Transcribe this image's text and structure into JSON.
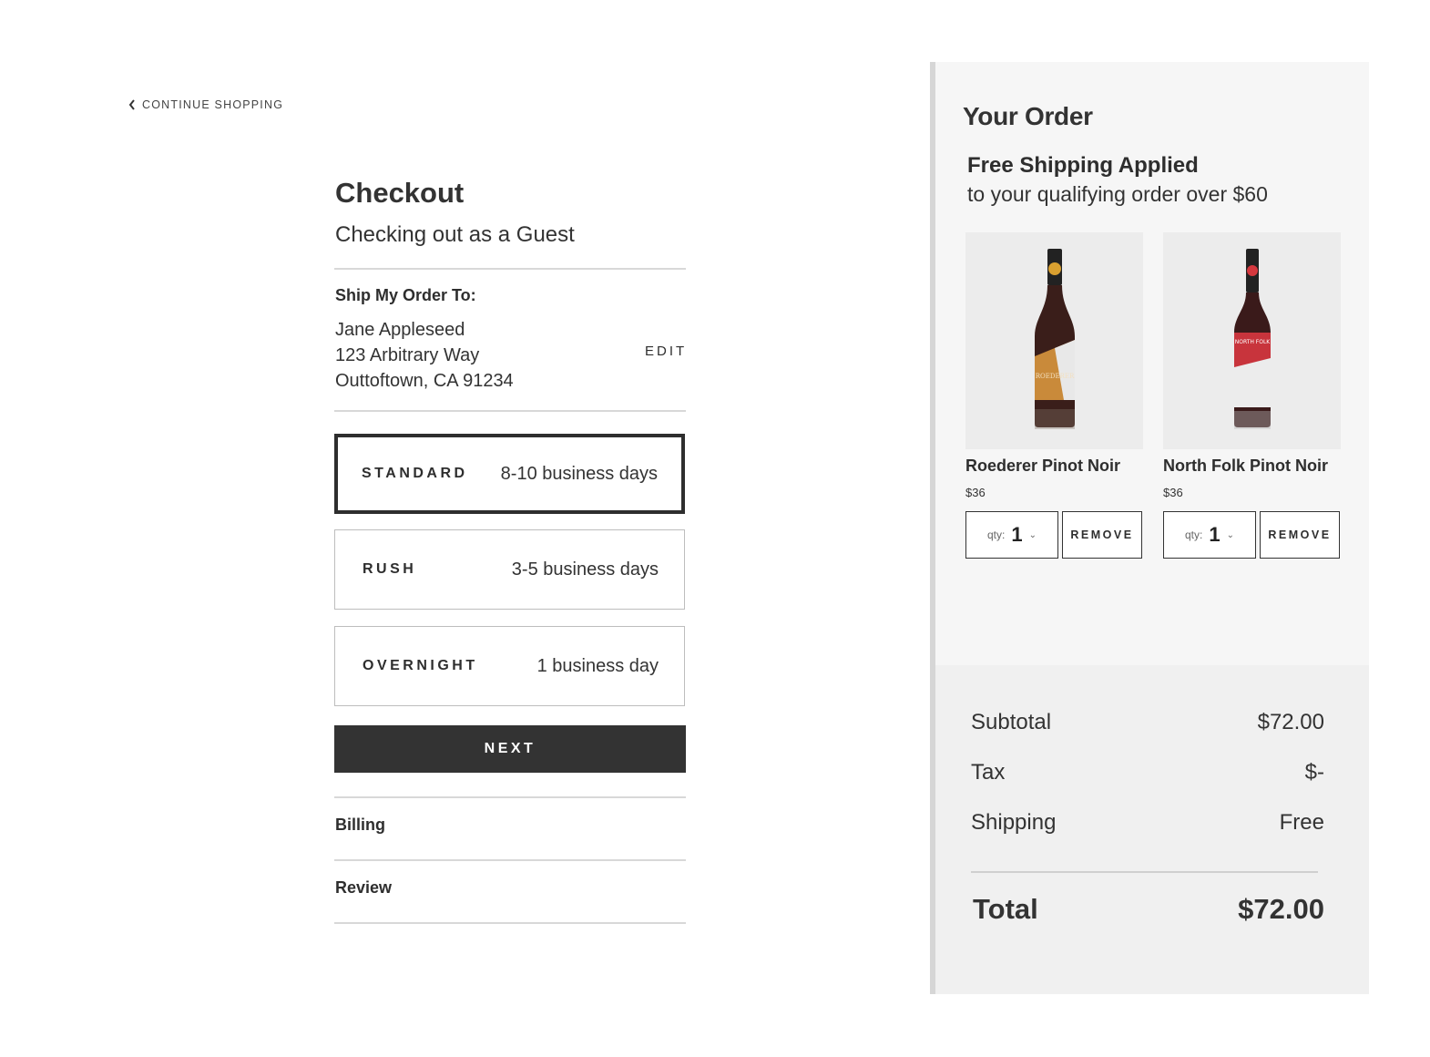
{
  "nav": {
    "continue_label": "CONTINUE SHOPPING"
  },
  "checkout": {
    "title": "Checkout",
    "subtitle": "Checking out as a Guest",
    "ship_to_label": "Ship My Order To:",
    "address": {
      "name": "Jane Appleseed",
      "street": "123 Arbitrary Way",
      "city": "Outtoftown, CA 91234"
    },
    "edit_label": "EDIT",
    "shipping_options": [
      {
        "name": "STANDARD",
        "days": "8-10 business days",
        "selected": true
      },
      {
        "name": "RUSH",
        "days": "3-5 business days",
        "selected": false
      },
      {
        "name": "OVERNIGHT",
        "days": "1 business day",
        "selected": false
      }
    ],
    "next_label": "NEXT",
    "steps": [
      "Billing",
      "Review"
    ]
  },
  "order": {
    "title": "Your Order",
    "free_shipping_title": "Free Shipping Applied",
    "free_shipping_sub": "to your qualifying order over $60",
    "products": [
      {
        "name": "Roederer Pinot Noir",
        "price": "$36",
        "qty_label": "qty:",
        "qty": "1",
        "remove_label": "REMOVE",
        "label_color": "#c98a3a",
        "cap_color": "#d9a030",
        "bottle_text": "ROEDERER"
      },
      {
        "name": "North Folk Pinot Noir",
        "price": "$36",
        "qty_label": "qty:",
        "qty": "1",
        "remove_label": "REMOVE",
        "label_color": "#c8343c",
        "cap_color": "#d5383e",
        "bottle_text": "NORTH FOLK"
      }
    ],
    "summary": {
      "subtotal_label": "Subtotal",
      "subtotal": "$72.00",
      "tax_label": "Tax",
      "tax": "$-",
      "shipping_label": "Shipping",
      "shipping": "Free",
      "total_label": "Total",
      "total": "$72.00"
    }
  },
  "colors": {
    "dark": "#333333",
    "panel": "#f6f6f6",
    "panel_bottom": "#f0f0f0"
  },
  "icons": {
    "back": "chevron-left-icon",
    "dropdown": "chevron-down-icon"
  }
}
